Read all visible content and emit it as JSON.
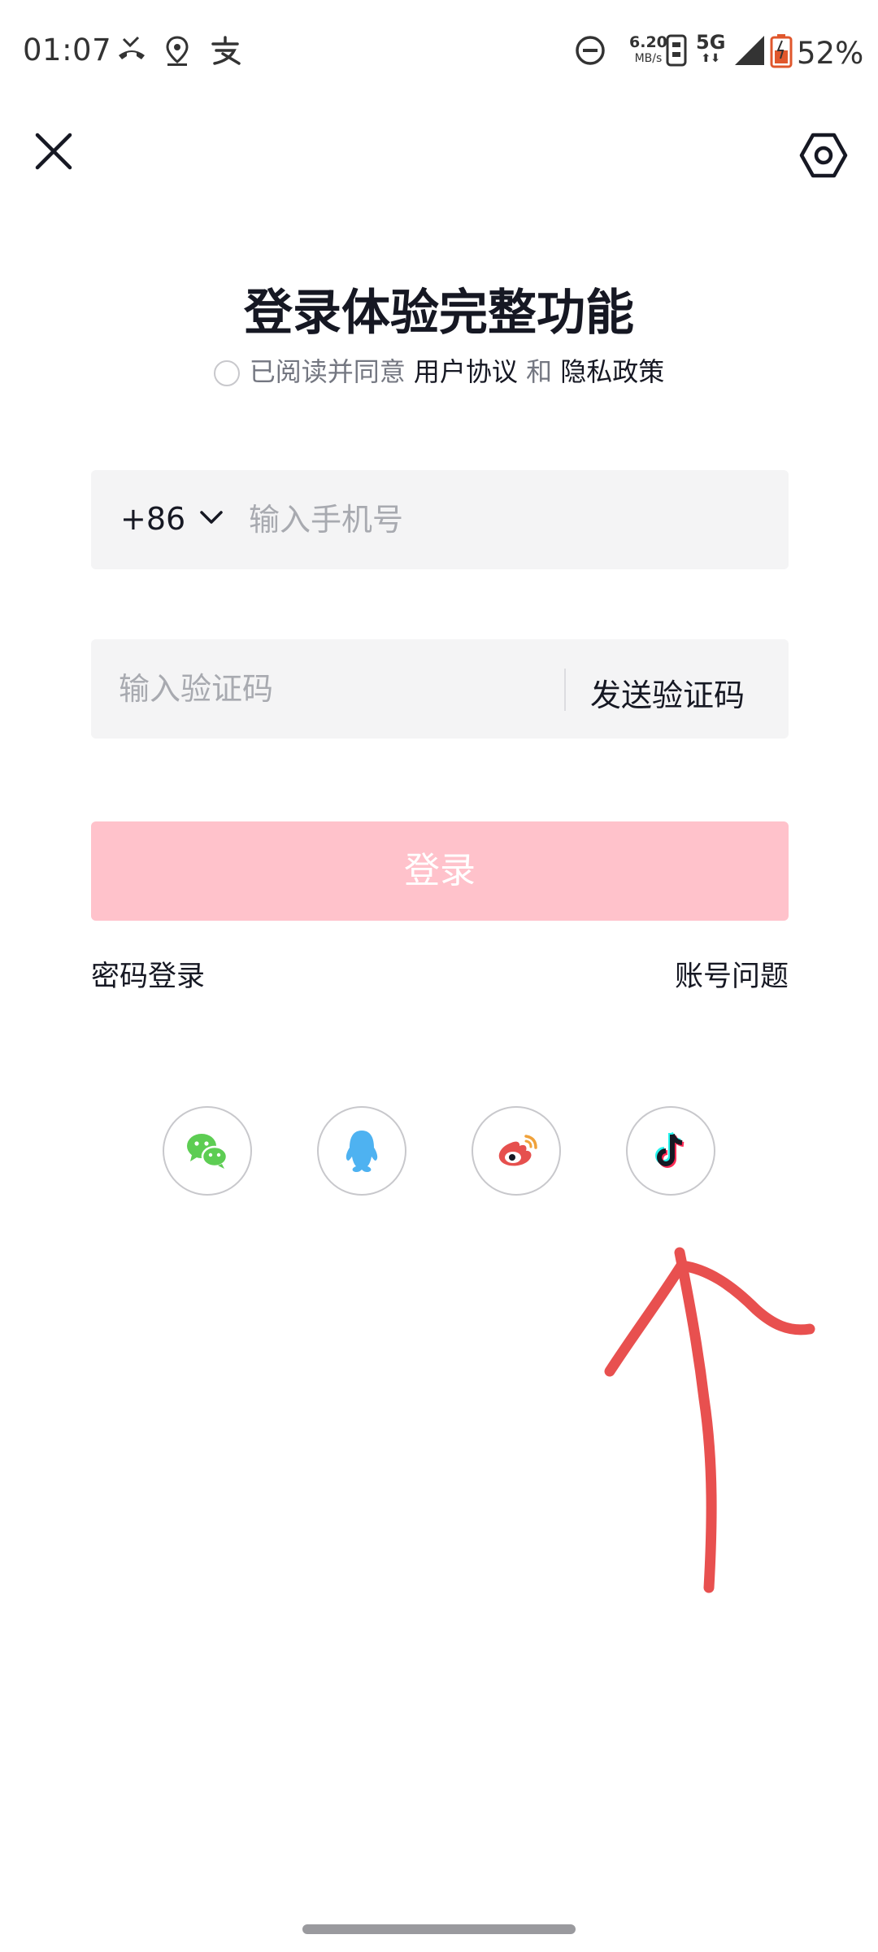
{
  "status_bar": {
    "time": "01:07",
    "net_speed_value": "6.20",
    "net_speed_unit": "MB/s",
    "network": "5G",
    "battery": "52%",
    "icons": [
      "missed-call-icon",
      "location-icon",
      "alipay-icon",
      "dnd-icon",
      "vibrate-icon",
      "signal-icon",
      "battery-icon"
    ]
  },
  "header": {
    "close_icon": "close-icon",
    "settings_icon": "settings-icon"
  },
  "title": "登录体验完整功能",
  "agreement": {
    "prefix": "已阅读并同意",
    "user_agreement": "用户协议",
    "and": "和",
    "privacy_policy": "隐私政策"
  },
  "phone_field": {
    "country_code": "+86",
    "placeholder": "输入手机号"
  },
  "code_field": {
    "placeholder": "输入验证码",
    "send_label": "发送验证码"
  },
  "login_button": {
    "label": "登录",
    "color": "#ffc2cb"
  },
  "links": {
    "password_login": "密码登录",
    "account_issue": "账号问题"
  },
  "social_logins": [
    {
      "name": "wechat-icon",
      "color": "#5dcd53"
    },
    {
      "name": "qq-icon",
      "color": "#4eb2f1"
    },
    {
      "name": "weibo-icon",
      "color": "#e6504e"
    },
    {
      "name": "douyin-icon",
      "color": "#161823"
    }
  ],
  "annotation": {
    "color": "#e8504f"
  }
}
